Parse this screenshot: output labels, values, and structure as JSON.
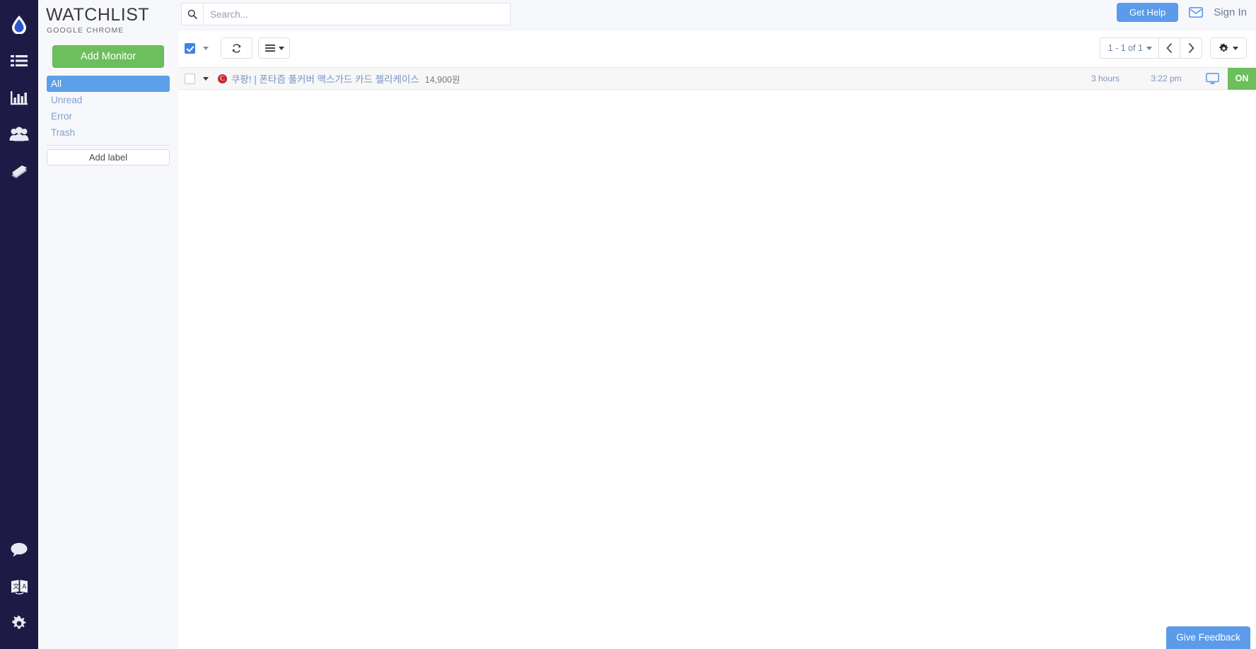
{
  "rail": {
    "top_items": [
      {
        "icon": "droplet-logo-icon",
        "name": "logo"
      },
      {
        "icon": "list-icon",
        "name": "monitors"
      },
      {
        "icon": "bar-chart-icon",
        "name": "stats"
      },
      {
        "icon": "users-icon",
        "name": "users"
      },
      {
        "icon": "book-icon",
        "name": "docs"
      }
    ],
    "bottom_items": [
      {
        "icon": "chat-bubble-icon",
        "name": "chat"
      },
      {
        "icon": "translate-icon",
        "name": "translate"
      },
      {
        "icon": "gear-icon",
        "name": "settings"
      }
    ]
  },
  "brand": {
    "title": "WATCHLIST",
    "subtitle": "GOOGLE CHROME"
  },
  "sidebar": {
    "add_monitor_label": "Add Monitor",
    "labels": [
      {
        "label": "All",
        "active": true
      },
      {
        "label": "Unread",
        "active": false
      },
      {
        "label": "Error",
        "active": false
      },
      {
        "label": "Trash",
        "active": false
      }
    ],
    "add_label_button": "Add label"
  },
  "search": {
    "value": "",
    "placeholder": "Search..."
  },
  "header": {
    "get_help_label": "Get Help",
    "sign_in_label": "Sign In"
  },
  "toolbar": {
    "select_all_checked": true,
    "refresh_title": "Refresh",
    "menu_title": "More actions",
    "pager_count": "1 - 1 of 1",
    "prev_label": "‹",
    "next_label": "›"
  },
  "list": {
    "rows": [
      {
        "checked": false,
        "favicon_letter": "C",
        "title": "쿠팡! | 폰타즘 풀커버 맥스가드 카드 젤리케이스",
        "price": "14,900원",
        "age": "3 hours",
        "time": "3:22 pm",
        "status": "ON"
      }
    ]
  },
  "feedback": {
    "label": "Give Feedback"
  },
  "colors": {
    "rail_bg": "#1d1b46",
    "panel_bg": "#f7f8fc",
    "accent_blue": "#5b9bea",
    "active_blue": "#5ba0e8",
    "green": "#6cbf5c",
    "link_blue": "#7593c7",
    "favicon_red": "#c8282e"
  }
}
